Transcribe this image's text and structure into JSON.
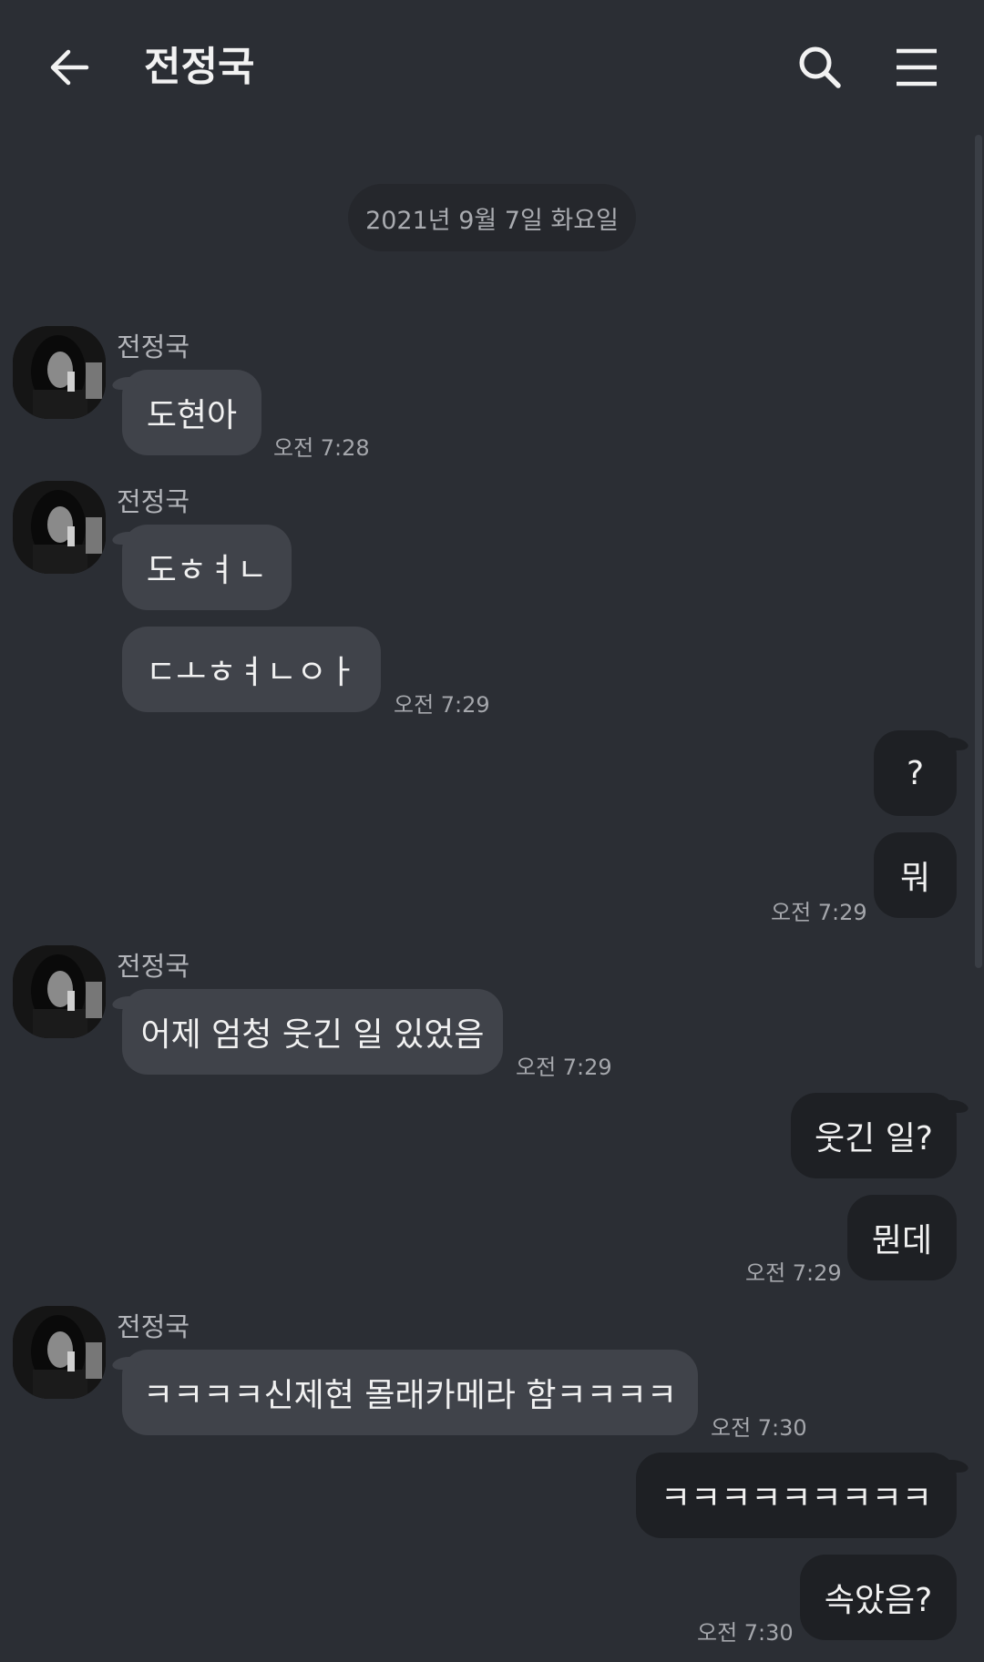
{
  "header": {
    "title": "전정국",
    "back_icon": "arrow-left-icon",
    "search_icon": "search-icon",
    "menu_icon": "menu-icon"
  },
  "date_divider": "2021년 9월 7일 화요일",
  "colors": {
    "background": "#2b2e34",
    "incoming_bubble": "#40434a",
    "outgoing_bubble": "#1e2024",
    "date_pill": "#25272c"
  },
  "messages": [
    {
      "side": "in",
      "sender": "전정국",
      "text": "도현아",
      "time": "오전 7:28"
    },
    {
      "side": "in",
      "sender": "전정국",
      "text": "도ㅎㅕㄴ",
      "time": ""
    },
    {
      "side": "in",
      "sender": "",
      "text": "ㄷㅗㅎㅕㄴㅇㅏ",
      "time": "오전 7:29"
    },
    {
      "side": "out",
      "text": "?",
      "time": ""
    },
    {
      "side": "out",
      "text": "뭐",
      "time": "오전 7:29"
    },
    {
      "side": "in",
      "sender": "전정국",
      "text": "어제 엄청 웃긴 일 있었음",
      "time": "오전 7:29"
    },
    {
      "side": "out",
      "text": "웃긴 일?",
      "time": ""
    },
    {
      "side": "out",
      "text": "뭔데",
      "time": "오전 7:29"
    },
    {
      "side": "in",
      "sender": "전정국",
      "text": "ㅋㅋㅋㅋ신제현 몰래카메라 함ㅋㅋㅋㅋ",
      "time": "오전 7:30"
    },
    {
      "side": "out",
      "text": "ㅋㅋㅋㅋㅋㅋㅋㅋㅋ",
      "time": ""
    },
    {
      "side": "out",
      "text": "속았음?",
      "time": "오전 7:30"
    }
  ]
}
